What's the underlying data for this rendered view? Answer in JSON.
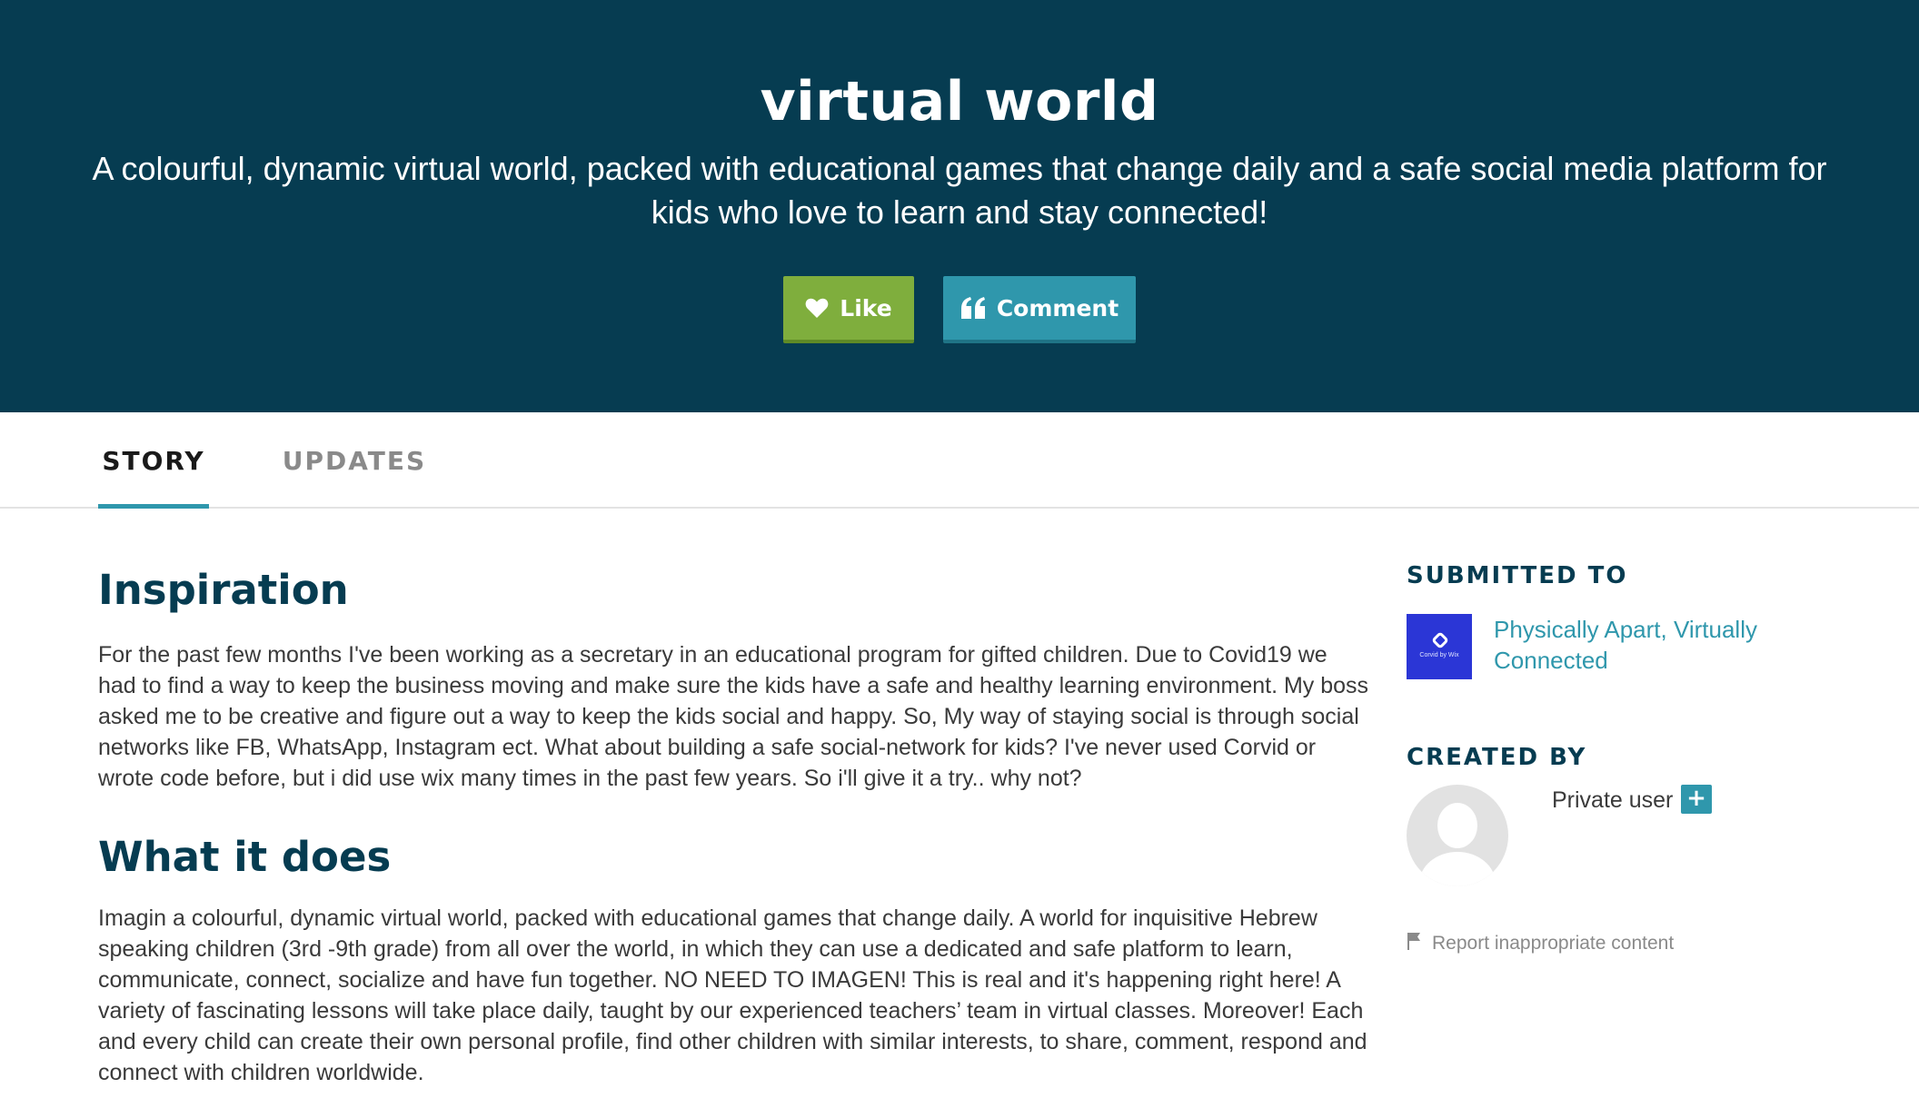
{
  "hero": {
    "title": "virtual world",
    "tagline": "A colourful, dynamic virtual world, packed with educational games that change daily and a safe social media platform for kids who love to learn and stay connected!",
    "like_label": "Like",
    "comment_label": "Comment",
    "like_icon": "heart-icon",
    "comment_icon": "quote-icon"
  },
  "tabs": {
    "story": "STORY",
    "updates": "UPDATES",
    "active": "story"
  },
  "story": {
    "sections": [
      {
        "heading": "Inspiration",
        "body": "For the past few months I've been working as a secretary in an educational program for gifted children. Due to Covid19 we had to find a way to keep the business moving and make sure the kids have a safe and healthy learning environment. My boss asked me to be creative and figure out a way to keep the kids social and happy. So, My way of staying social is through social networks like FB, WhatsApp, Instagram ect. What about building a safe social-network for kids? I've never used Corvid or wrote code before, but i did use wix many times in the past few years. So i'll give it a try.. why not?"
      },
      {
        "heading": "What it does",
        "body": "Imagin a colourful, dynamic virtual world, packed with educational games that change daily. A world for inquisitive Hebrew speaking children (3rd -9th grade) from all over the world, in which they can use a dedicated and safe platform to learn, communicate, connect, socialize and have fun together. NO NEED TO IMAGEN! This is real and it's happening right here! A variety of fascinating lessons will take place daily, taught by our experienced teachers’ team in virtual classes. Moreover! Each and every child can create their own personal profile, find other children with similar interests, to share, comment, respond and connect with children worldwide."
      }
    ]
  },
  "sidebar": {
    "submitted_heading": "SUBMITTED TO",
    "challenge_name": "Physically Apart, Virtually Connected",
    "challenge_thumb_text": "Corvid by Wix",
    "created_heading": "CREATED BY",
    "creator_name": "Private user",
    "follow_label": "+",
    "report_label": "Report inappropriate content",
    "report_icon": "flag-icon"
  },
  "colors": {
    "hero_bg": "#063c51",
    "like_green": "#7fae3d",
    "accent_teal": "#2f97ac",
    "heading_navy": "#063c51",
    "challenge_blue": "#2b36d6"
  }
}
